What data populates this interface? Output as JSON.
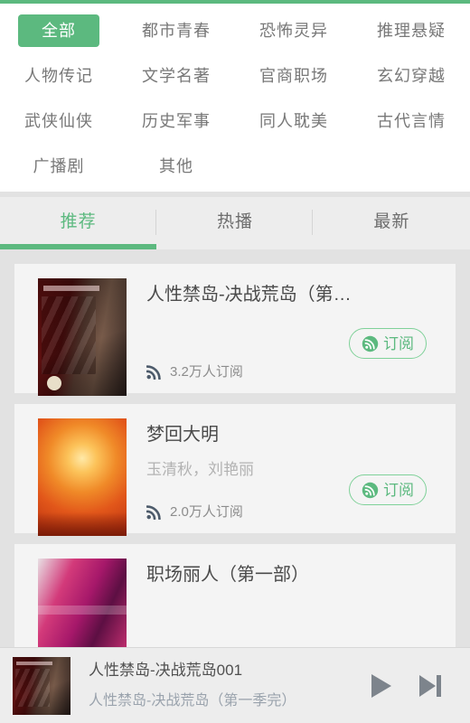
{
  "theme": {
    "accent": "#5cb97f",
    "page_bg": "#e2e2e2",
    "panel_bg": "#ffffff",
    "tabbar_bg": "#ededed",
    "card_bg": "#f4f4f4",
    "muted_text": "#b2b2b2",
    "rss_icon_color": "#4d5b6b",
    "player_icon_color": "#7d848c"
  },
  "categories": {
    "items": [
      {
        "label": "全部",
        "active": true
      },
      {
        "label": "都市青春",
        "active": false
      },
      {
        "label": "恐怖灵异",
        "active": false
      },
      {
        "label": "推理悬疑",
        "active": false
      },
      {
        "label": "人物传记",
        "active": false
      },
      {
        "label": "文学名著",
        "active": false
      },
      {
        "label": "官商职场",
        "active": false
      },
      {
        "label": "玄幻穿越",
        "active": false
      },
      {
        "label": "武侠仙侠",
        "active": false
      },
      {
        "label": "历史军事",
        "active": false
      },
      {
        "label": "同人耽美",
        "active": false
      },
      {
        "label": "古代言情",
        "active": false
      },
      {
        "label": "广播剧",
        "active": false
      },
      {
        "label": "其他",
        "active": false
      }
    ]
  },
  "tabs": {
    "items": [
      {
        "label": "推荐",
        "active": true
      },
      {
        "label": "热播",
        "active": false
      },
      {
        "label": "最新",
        "active": false
      }
    ]
  },
  "list": {
    "subscribe_label": "订阅",
    "items": [
      {
        "title": "人性禁岛-决战荒岛（第…",
        "author": "",
        "subscribers": "3.2万人订阅",
        "cover_icon": "album-cover-human-forbidden-island"
      },
      {
        "title": "梦回大明",
        "author": "玉清秋，刘艳丽",
        "subscribers": "2.0万人订阅",
        "cover_icon": "album-cover-dream-back-to-ming"
      },
      {
        "title": "职场丽人（第一部）",
        "author": "",
        "subscribers": "",
        "cover_icon": "album-cover-office-lady"
      }
    ]
  },
  "player": {
    "track_title": "人性禁岛-决战荒岛001",
    "album_title": "人性禁岛-决战荒岛（第一季完）",
    "cover_icon": "player-album-cover",
    "play_icon": "play-icon",
    "next_icon": "next-track-icon"
  }
}
